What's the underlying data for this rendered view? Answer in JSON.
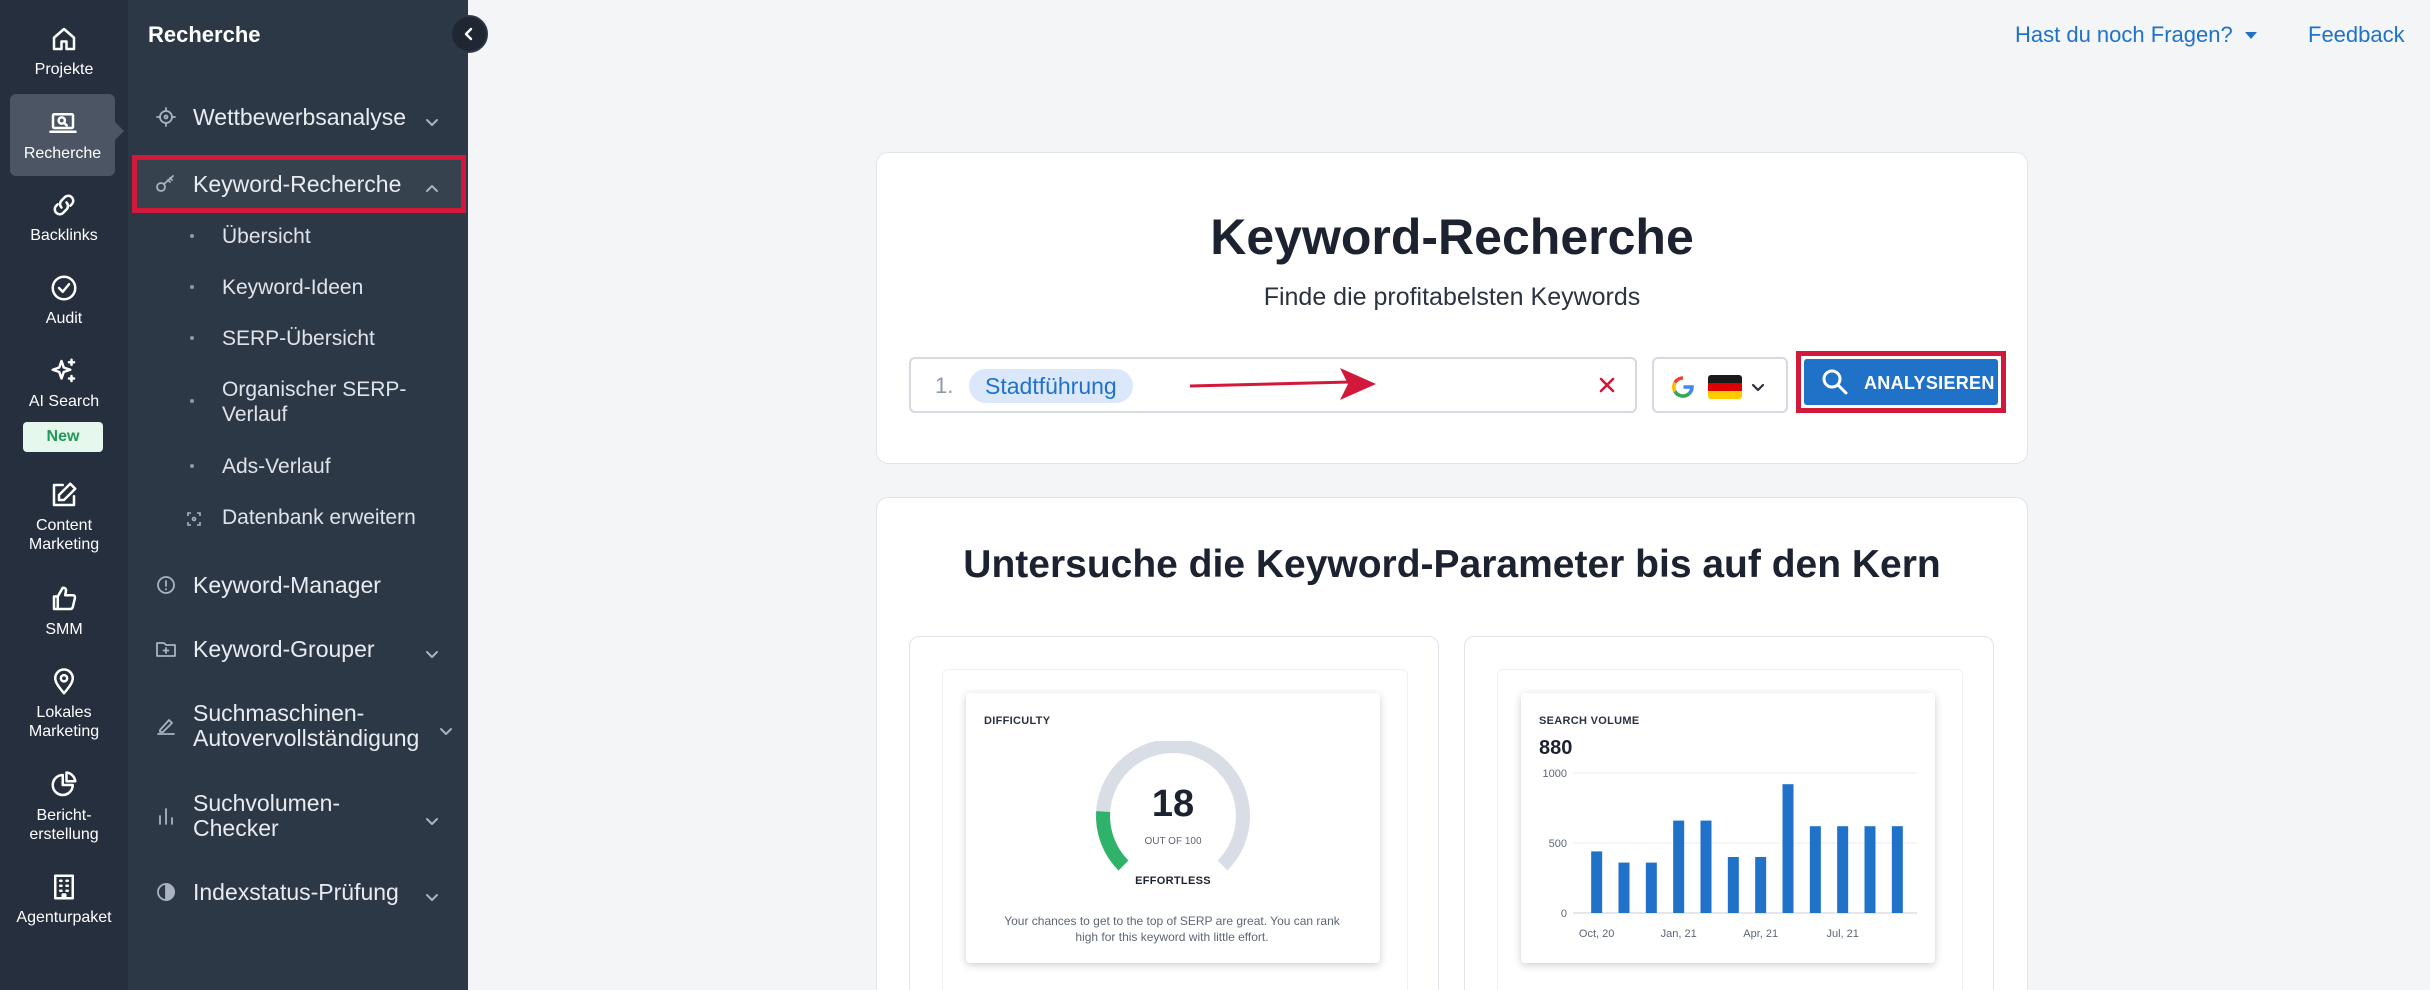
{
  "rail": {
    "items": [
      {
        "label": "Projekte",
        "icon": "home-icon"
      },
      {
        "label": "Recherche",
        "icon": "research-icon"
      },
      {
        "label": "Backlinks",
        "icon": "link-icon"
      },
      {
        "label": "Audit",
        "icon": "check-circle-icon"
      },
      {
        "label": "AI Search",
        "icon": "sparkle-icon"
      },
      {
        "label": "Content Marketing",
        "icon": "edit-icon"
      },
      {
        "label": "SMM",
        "icon": "thumbs-up-icon"
      },
      {
        "label": "Lokales Marketing",
        "icon": "location-pin-icon"
      },
      {
        "label": "Bericht-erstellung",
        "icon": "pie-chart-icon"
      },
      {
        "label": "Agenturpaket",
        "icon": "building-icon"
      }
    ],
    "new_badge": "New"
  },
  "sidebar": {
    "title": "Recherche",
    "items": [
      {
        "label": "Wettbewerbsanalyse"
      },
      {
        "label": "Keyword-Recherche"
      },
      {
        "label": "Keyword-Manager"
      },
      {
        "label": "Keyword-Grouper"
      },
      {
        "label": "Suchmaschinen-Autovervollständigung"
      },
      {
        "label": "Suchvolumen-Checker"
      },
      {
        "label": "Indexstatus-Prüfung"
      }
    ],
    "subitems": [
      {
        "label": "Übersicht"
      },
      {
        "label": "Keyword-Ideen"
      },
      {
        "label": "SERP-Übersicht"
      },
      {
        "label": "Organischer SERP-Verlauf"
      },
      {
        "label": "Ads-Verlauf"
      },
      {
        "label": "Datenbank erweitern"
      }
    ]
  },
  "header": {
    "help_label": "Hast du noch Fragen?",
    "feedback_label": "Feedback"
  },
  "hero": {
    "title": "Keyword-Recherche",
    "subtitle": "Finde die profitabelsten Keywords",
    "search": {
      "row_number": "1.",
      "keyword": "Stadtführung"
    },
    "analyze_label": "ANALYSIEREN"
  },
  "features": {
    "title": "Untersuche die Keyword-Parameter bis auf den Kern",
    "difficulty": {
      "label": "DIFFICULTY",
      "value": "18",
      "value_num": 18,
      "out_of": "OUT OF 100",
      "state": "EFFORTLESS",
      "description": "Your chances to get to the top of SERP are great. You can rank high for this keyword with little effort."
    },
    "search_volume": {
      "label": "SEARCH VOLUME",
      "value": "880"
    }
  },
  "chart_data": {
    "type": "bar",
    "title": "SEARCH VOLUME",
    "ylim": [
      0,
      1000
    ],
    "yticks": [
      "1000",
      "500",
      "0"
    ],
    "xticks": [
      "Oct, 20",
      "Jan, 21",
      "Apr, 21",
      "Jul, 21"
    ],
    "values": [
      440,
      360,
      360,
      660,
      660,
      400,
      400,
      920,
      620,
      620,
      620,
      620
    ],
    "color": "#1f72c8"
  }
}
